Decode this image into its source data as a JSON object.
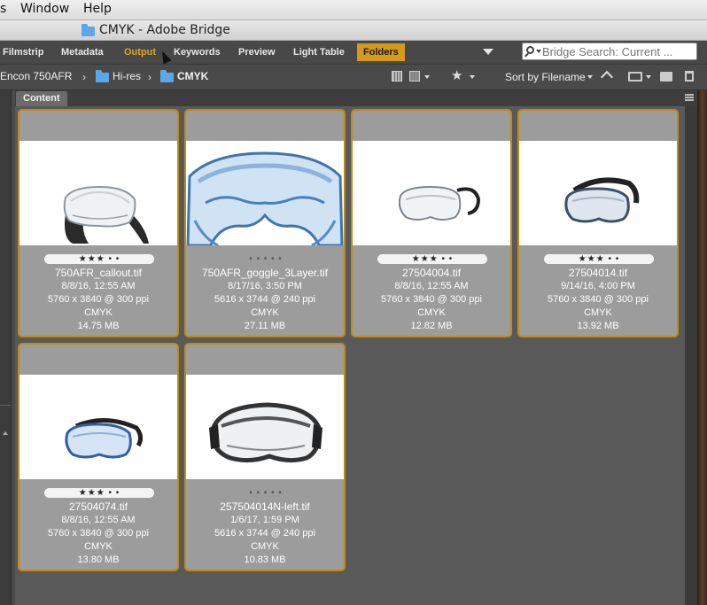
{
  "menubar": {
    "partial": "s",
    "window": "Window",
    "help": "Help"
  },
  "window": {
    "title": "CMYK - Adobe Bridge"
  },
  "workspace": {
    "tabs": [
      "Filmstrip",
      "Metadata",
      "Output",
      "Keywords",
      "Preview",
      "Light Table",
      "Folders"
    ],
    "active": "Folders",
    "hover": "Output"
  },
  "search": {
    "placeholder": "Bridge Search: Current ..."
  },
  "path": {
    "crumbs": [
      "Encon 750AFR",
      "Hi-res",
      "CMYK"
    ]
  },
  "toolbar": {
    "sort_label": "Sort by Filename"
  },
  "panel": {
    "tab_label": "Content"
  },
  "items": [
    {
      "rating": "★★★ • •",
      "filename": "750AFR_callout.tif",
      "date": "8/8/16, 12:55 AM",
      "dims": "5760 x 3840 @ 300 ppi",
      "mode": "CMYK",
      "size": "14.75 MB"
    },
    {
      "rating": "• • • • •",
      "filename": "750AFR_goggle_3Layer.tif",
      "date": "8/17/16, 3:50 PM",
      "dims": "5616 x 3744 @ 240 ppi",
      "mode": "CMYK",
      "size": "27.11 MB"
    },
    {
      "rating": "★★★ • •",
      "filename": "27504004.tif",
      "date": "8/8/16, 12:55 AM",
      "dims": "5760 x 3840 @ 300 ppi",
      "mode": "CMYK",
      "size": "12.82 MB"
    },
    {
      "rating": "★★★ • •",
      "filename": "27504014.tif",
      "date": "9/14/16, 4:00 PM",
      "dims": "5760 x 3840 @ 300 ppi",
      "mode": "CMYK",
      "size": "13.92 MB"
    },
    {
      "rating": "★★★ • •",
      "filename": "27504074.tif",
      "date": "8/8/16, 12:55 AM",
      "dims": "5760 x 3840 @ 300 ppi",
      "mode": "CMYK",
      "size": "13.80 MB"
    },
    {
      "rating": "• • • • •",
      "filename": "257504014N-left.tif",
      "date": "1/6/17, 1:59 PM",
      "dims": "5616 x 3744 @ 240 ppi",
      "mode": "CMYK",
      "size": "10.83 MB"
    }
  ],
  "colors": {
    "accent": "#d49a1a",
    "thumb_border": "#c08a14",
    "panel_bg": "#595959"
  }
}
